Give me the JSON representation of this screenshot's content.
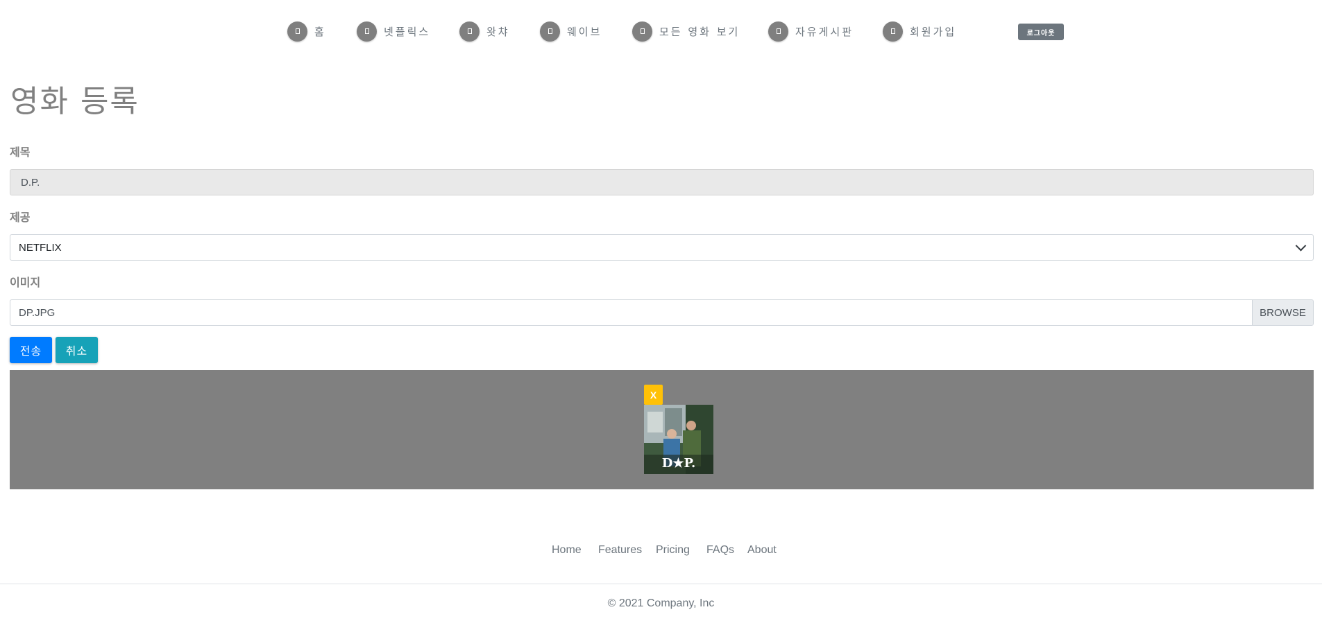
{
  "nav": {
    "items": [
      {
        "label": "홈",
        "icon": "home-icon"
      },
      {
        "label": "넷플릭스",
        "icon": "netflix-icon"
      },
      {
        "label": "왓챠",
        "icon": "watcha-icon"
      },
      {
        "label": "웨이브",
        "icon": "wavve-icon"
      },
      {
        "label": "모든 영화 보기",
        "icon": "movies-icon"
      },
      {
        "label": "자유게시판",
        "icon": "board-icon"
      },
      {
        "label": "회원가입",
        "icon": "signup-icon"
      }
    ],
    "logout_label": "로그아웃"
  },
  "form": {
    "page_title": "영화 등록",
    "title_label": "제목",
    "title_value": "D.P.",
    "provider_label": "제공",
    "provider_selected": "NETFLIX",
    "image_label": "이미지",
    "image_filename": "DP.JPG",
    "browse_label": "BROWSE",
    "submit_label": "전송",
    "cancel_label": "취소"
  },
  "preview": {
    "remove_label": "X",
    "poster_title": "D★P."
  },
  "footer": {
    "links": [
      "Home",
      "Features",
      "Pricing",
      "FAQs",
      "About"
    ],
    "copyright": "© 2021 Company, Inc"
  },
  "colors": {
    "primary": "#007bff",
    "info": "#17a2b8",
    "secondary": "#6c757d",
    "warning": "#ffc107",
    "preview_bg": "#808080"
  }
}
